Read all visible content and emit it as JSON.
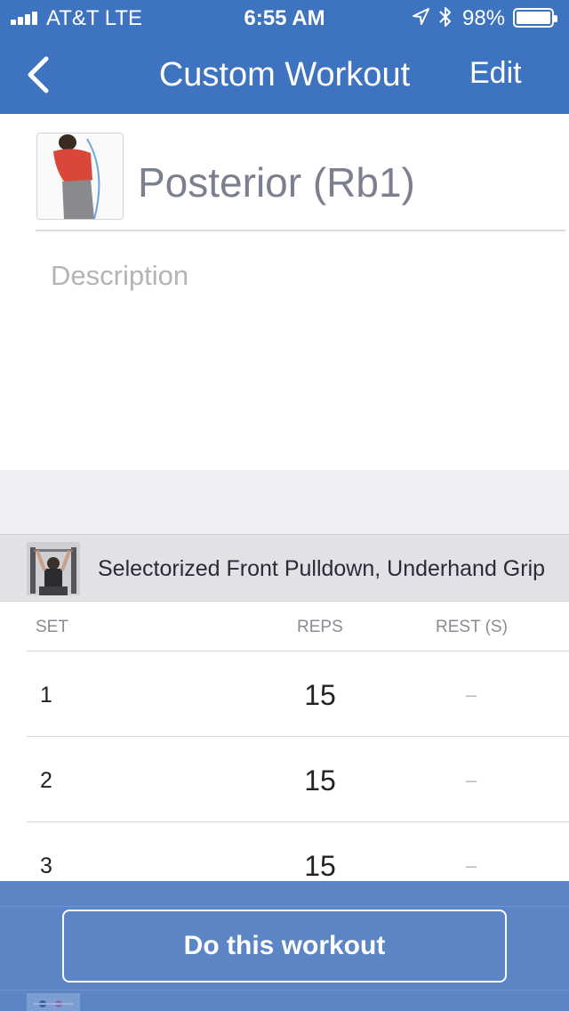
{
  "status_bar": {
    "carrier": "AT&T  LTE",
    "time": "6:55 AM",
    "battery": "98%",
    "battery_level": 0.98
  },
  "nav": {
    "back_icon": "chevron-left-icon",
    "title": "Custom Workout",
    "edit_label": "Edit"
  },
  "workout": {
    "name": "Posterior (Rb1)",
    "description_placeholder": "Description"
  },
  "exercise": {
    "name": "Selectorized Front Pulldown, Underhand Grip"
  },
  "table": {
    "headers": {
      "set": "SET",
      "reps": "REPS",
      "rest": "REST (S)"
    },
    "rows": [
      {
        "set": "1",
        "reps": "15",
        "rest": "–"
      },
      {
        "set": "2",
        "reps": "15",
        "rest": "–"
      },
      {
        "set": "3",
        "reps": "15",
        "rest": "–"
      }
    ]
  },
  "action": {
    "label": "Do this workout"
  },
  "colors": {
    "accent": "#3d73bf",
    "action_bar": "#5c85c6",
    "title_gray": "#7c7f90"
  }
}
